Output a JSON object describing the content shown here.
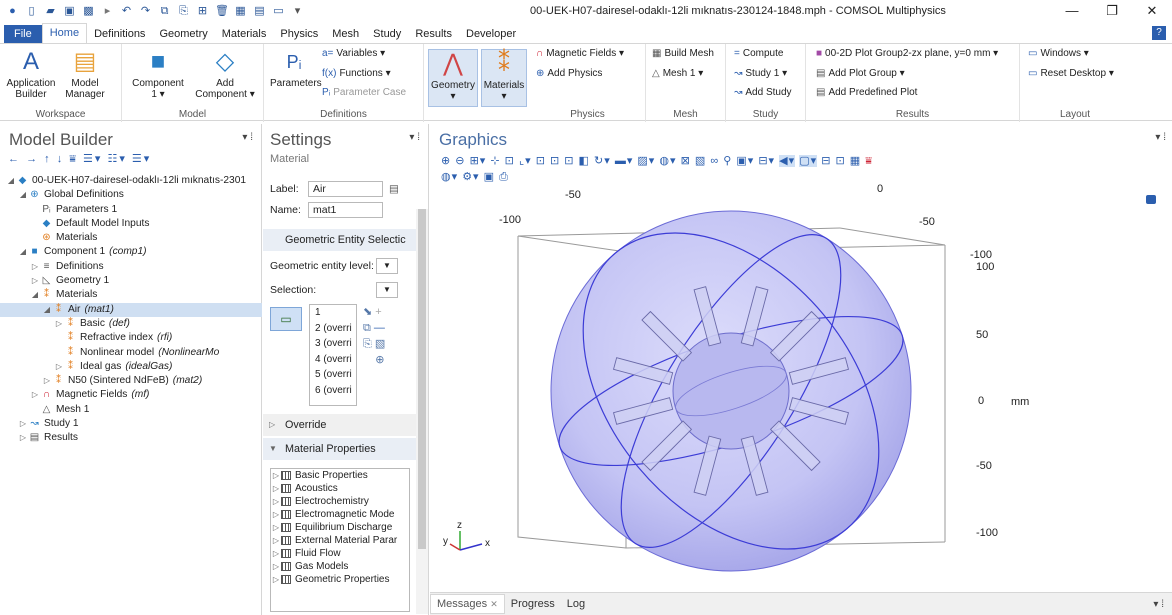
{
  "window": {
    "title": "00-UEK-H07-dairesel-odaklı-12li mıknatıs-230124-1848.mph - COMSOL Multiphysics",
    "minimize": "—",
    "restore": "❐",
    "close": "✕"
  },
  "menu": {
    "tabs": [
      "File",
      "Home",
      "Definitions",
      "Geometry",
      "Materials",
      "Physics",
      "Mesh",
      "Study",
      "Results",
      "Developer"
    ],
    "help": "?"
  },
  "ribbon": {
    "workspace": {
      "label": "Workspace",
      "app_builder": "Application\nBuilder",
      "model_manager": "Model\nManager"
    },
    "model": {
      "label": "Model",
      "component": "Component\n1 ▾",
      "add_component": "Add\nComponent ▾"
    },
    "definitions": {
      "label": "Definitions",
      "parameters": "Parameters",
      "variables": "Variables ▾",
      "functions": "Functions ▾",
      "parameter_case": "Parameter Case"
    },
    "geometry_btn": "Geometry\n▾",
    "materials_btn": "Materials\n▾",
    "physics": {
      "label": "Physics",
      "magnetic_fields": "Magnetic Fields ▾",
      "add_physics": "Add Physics"
    },
    "mesh": {
      "label": "Mesh",
      "build_mesh": "Build Mesh",
      "mesh1": "Mesh 1 ▾"
    },
    "study": {
      "label": "Study",
      "compute": "Compute",
      "study1": "Study 1 ▾",
      "add_study": "Add Study"
    },
    "results": {
      "label": "Results",
      "plot_group": "00-2D Plot Group2-zx plane, y=0 mm ▾",
      "add_plot_group": "Add Plot Group ▾",
      "add_predefined_plot": "Add Predefined Plot"
    },
    "layout": {
      "label": "Layout",
      "windows": "Windows ▾",
      "reset_desktop": "Reset Desktop ▾"
    }
  },
  "model_builder": {
    "title": "Model Builder",
    "tree": [
      {
        "indent": 0,
        "arrow": "◢",
        "icon": "◆",
        "label": "00-UEK-H07-dairesel-odaklı-12li mıknatıs-2301",
        "tag": ""
      },
      {
        "indent": 1,
        "arrow": "◢",
        "icon": "⊕",
        "label": "Global Definitions",
        "tag": ""
      },
      {
        "indent": 2,
        "arrow": "",
        "icon": "Pᵢ",
        "label": "Parameters 1",
        "tag": ""
      },
      {
        "indent": 2,
        "arrow": "",
        "icon": "◆",
        "label": "Default Model Inputs",
        "tag": ""
      },
      {
        "indent": 2,
        "arrow": "",
        "icon": "⊛",
        "label": "Materials",
        "tag": ""
      },
      {
        "indent": 1,
        "arrow": "◢",
        "icon": "■",
        "label": "Component 1",
        "tag": "(comp1)"
      },
      {
        "indent": 2,
        "arrow": "▷",
        "icon": "≡",
        "label": "Definitions",
        "tag": ""
      },
      {
        "indent": 2,
        "arrow": "▷",
        "icon": "◺",
        "label": "Geometry 1",
        "tag": ""
      },
      {
        "indent": 2,
        "arrow": "◢",
        "icon": "⁑",
        "label": "Materials",
        "tag": ""
      },
      {
        "indent": 3,
        "arrow": "◢",
        "icon": "⁑",
        "label": "Air",
        "tag": "(mat1)",
        "selected": true
      },
      {
        "indent": 4,
        "arrow": "▷",
        "icon": "⁑",
        "label": "Basic",
        "tag": "(def)"
      },
      {
        "indent": 4,
        "arrow": "",
        "icon": "⁑",
        "label": "Refractive index",
        "tag": "(rfi)"
      },
      {
        "indent": 4,
        "arrow": "",
        "icon": "⁑",
        "label": "Nonlinear model",
        "tag": "(NonlinearMo"
      },
      {
        "indent": 4,
        "arrow": "▷",
        "icon": "⁑",
        "label": "Ideal gas",
        "tag": "(idealGas)"
      },
      {
        "indent": 3,
        "arrow": "▷",
        "icon": "⁑",
        "label": "N50 (Sintered NdFeB)",
        "tag": "(mat2)"
      },
      {
        "indent": 2,
        "arrow": "▷",
        "icon": "∩",
        "label": "Magnetic Fields",
        "tag": "(mf)"
      },
      {
        "indent": 2,
        "arrow": "",
        "icon": "△",
        "label": "Mesh 1",
        "tag": ""
      },
      {
        "indent": 1,
        "arrow": "▷",
        "icon": "↝",
        "label": "Study 1",
        "tag": ""
      },
      {
        "indent": 1,
        "arrow": "▷",
        "icon": "▤",
        "label": "Results",
        "tag": ""
      }
    ]
  },
  "settings": {
    "title": "Settings",
    "type": "Material",
    "label_lbl": "Label:",
    "label_val": "Air",
    "name_lbl": "Name:",
    "name_val": "mat1",
    "geo_section": "Geometric Entity Selectic",
    "entity_level_lbl": "Geometric entity level:",
    "selection_lbl": "Selection:",
    "selection_items": [
      "1",
      "2 (overri",
      "3 (overri",
      "4 (overri",
      "5 (overri",
      "6 (overri"
    ],
    "override": "Override",
    "mat_props": "Material Properties",
    "mat_props_list": [
      "Basic Properties",
      "Acoustics",
      "Electrochemistry",
      "Electromagnetic Mode",
      "Equilibrium Discharge",
      "External Material Parar",
      "Fluid Flow",
      "Gas Models",
      "Geometric Properties"
    ]
  },
  "graphics": {
    "title": "Graphics",
    "axis_labels": [
      "-50",
      "-100",
      "0",
      "-50",
      "-100",
      "100",
      "50",
      "0",
      "mm",
      "-50",
      "-100"
    ],
    "triad": {
      "x": "x",
      "y": "y",
      "z": "z"
    }
  },
  "messages": {
    "tabs": [
      "Messages",
      "Progress",
      "Log"
    ],
    "close": "✕"
  },
  "icons": {
    "accent": "#2b5eae",
    "sphere_fill": "#c8c8f5",
    "sphere_line": "#3c3cd6"
  }
}
